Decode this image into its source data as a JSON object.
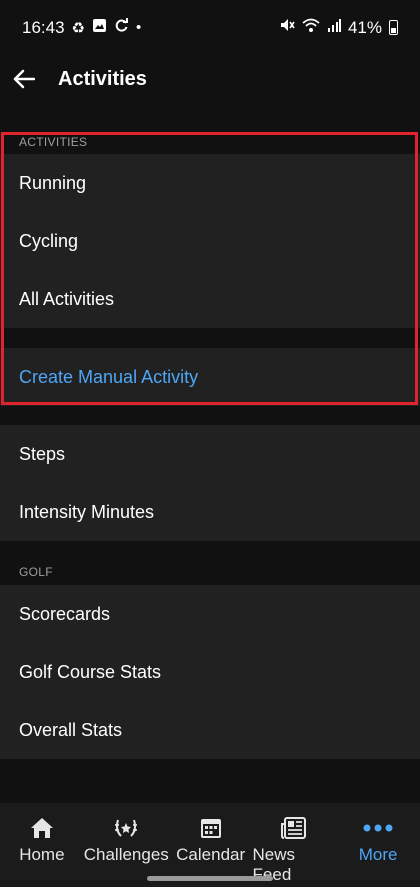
{
  "status_bar": {
    "time": "16:43",
    "battery": "41%",
    "icons": [
      "recycle-icon",
      "image-icon",
      "sync-icon",
      "dot-icon",
      "mute-icon",
      "wifi-icon",
      "signal-icon",
      "battery-icon"
    ]
  },
  "app_bar": {
    "title": "Activities"
  },
  "sections": {
    "activities_header": "ACTIVITIES",
    "golf_header": "GOLF"
  },
  "items": {
    "running": "Running",
    "cycling": "Cycling",
    "all_activities": "All Activities",
    "create_manual": "Create Manual Activity",
    "steps": "Steps",
    "intensity": "Intensity Minutes",
    "scorecards": "Scorecards",
    "golf_course_stats": "Golf Course Stats",
    "overall_stats": "Overall Stats"
  },
  "nav": {
    "home": "Home",
    "challenges": "Challenges",
    "calendar": "Calendar",
    "news_feed": "News Feed",
    "more": "More"
  },
  "colors": {
    "accent": "#4ea6f5",
    "highlight_border": "#e0232d",
    "row_bg": "#212121",
    "page_bg": "#111111"
  }
}
